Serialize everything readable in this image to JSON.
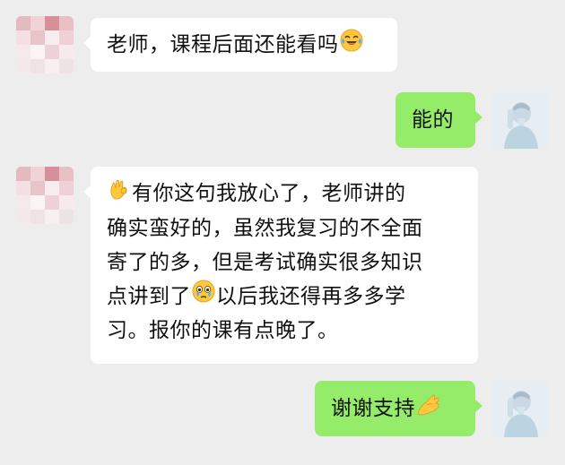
{
  "messages": [
    {
      "side": "left",
      "lines": [
        {
          "text_before": "老师，课程后面还能看吗",
          "emoji": "laughing-crying-emoji",
          "text_after": ""
        }
      ]
    },
    {
      "side": "right",
      "lines": [
        {
          "text": "能的"
        }
      ]
    },
    {
      "side": "left",
      "lines": [
        {
          "emoji_lead": "ok-hand-emoji",
          "text": "有你这句我放心了，老师讲的"
        },
        {
          "text": "确实蛮好的，虽然我复习的不全面"
        },
        {
          "text": "寄了的多，但是考试确实很多知识"
        },
        {
          "text_before": "点讲到了",
          "emoji": "teary-eyed-emoji",
          "text_after": "以后我还得再多多学"
        },
        {
          "text": "习。报你的课有点晚了。"
        }
      ]
    },
    {
      "side": "right",
      "lines": [
        {
          "text": "谢谢支持",
          "emoji_trail": "pinched-fingers-emoji"
        }
      ]
    }
  ],
  "colors": {
    "background": "#ededed",
    "bubble_received": "#ffffff",
    "bubble_sent": "#95ec69",
    "text": "#111111"
  }
}
